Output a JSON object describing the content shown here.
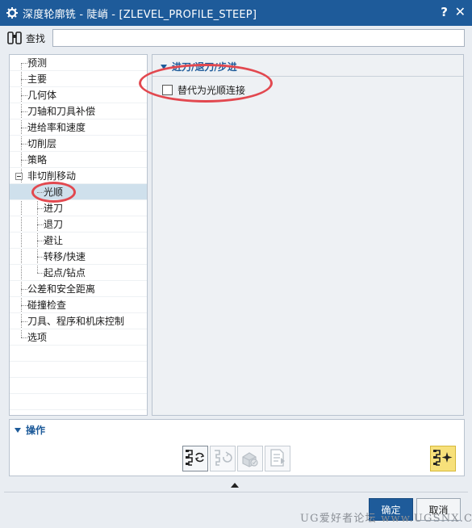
{
  "window": {
    "title": "深度轮廓铣 - 陡峭 - [ZLEVEL_PROFILE_STEEP]",
    "help": "?",
    "close": "✕"
  },
  "search": {
    "label": "查找",
    "value": ""
  },
  "tree": {
    "items": [
      {
        "label": "预测"
      },
      {
        "label": "主要"
      },
      {
        "label": "几何体"
      },
      {
        "label": "刀轴和刀具补偿"
      },
      {
        "label": "进给率和速度"
      },
      {
        "label": "切削层"
      },
      {
        "label": "策略"
      },
      {
        "label": "非切削移动"
      },
      {
        "label": "光顺"
      },
      {
        "label": "进刀"
      },
      {
        "label": "退刀"
      },
      {
        "label": "避让"
      },
      {
        "label": "转移/快速"
      },
      {
        "label": "起点/钻点"
      },
      {
        "label": "公差和安全距离"
      },
      {
        "label": "碰撞检查"
      },
      {
        "label": "刀具、程序和机床控制"
      },
      {
        "label": "选项"
      }
    ],
    "selected": "光顺"
  },
  "group": {
    "title": "进刀/退刀/步进",
    "option_label": "替代为光顺连接",
    "option_checked": false
  },
  "operations": {
    "title": "操作",
    "icons": [
      "generate-icon",
      "replay-icon",
      "verify-icon",
      "list-icon",
      "ai-toolpath-icon"
    ]
  },
  "buttons": {
    "ok": "确定",
    "cancel": "取消"
  },
  "watermark": "UG爱好者论坛 www.UGSNX.COM",
  "colors": {
    "accent": "#1e5b9a",
    "annotation": "#e2484f",
    "highlight": "#f7e07a"
  }
}
